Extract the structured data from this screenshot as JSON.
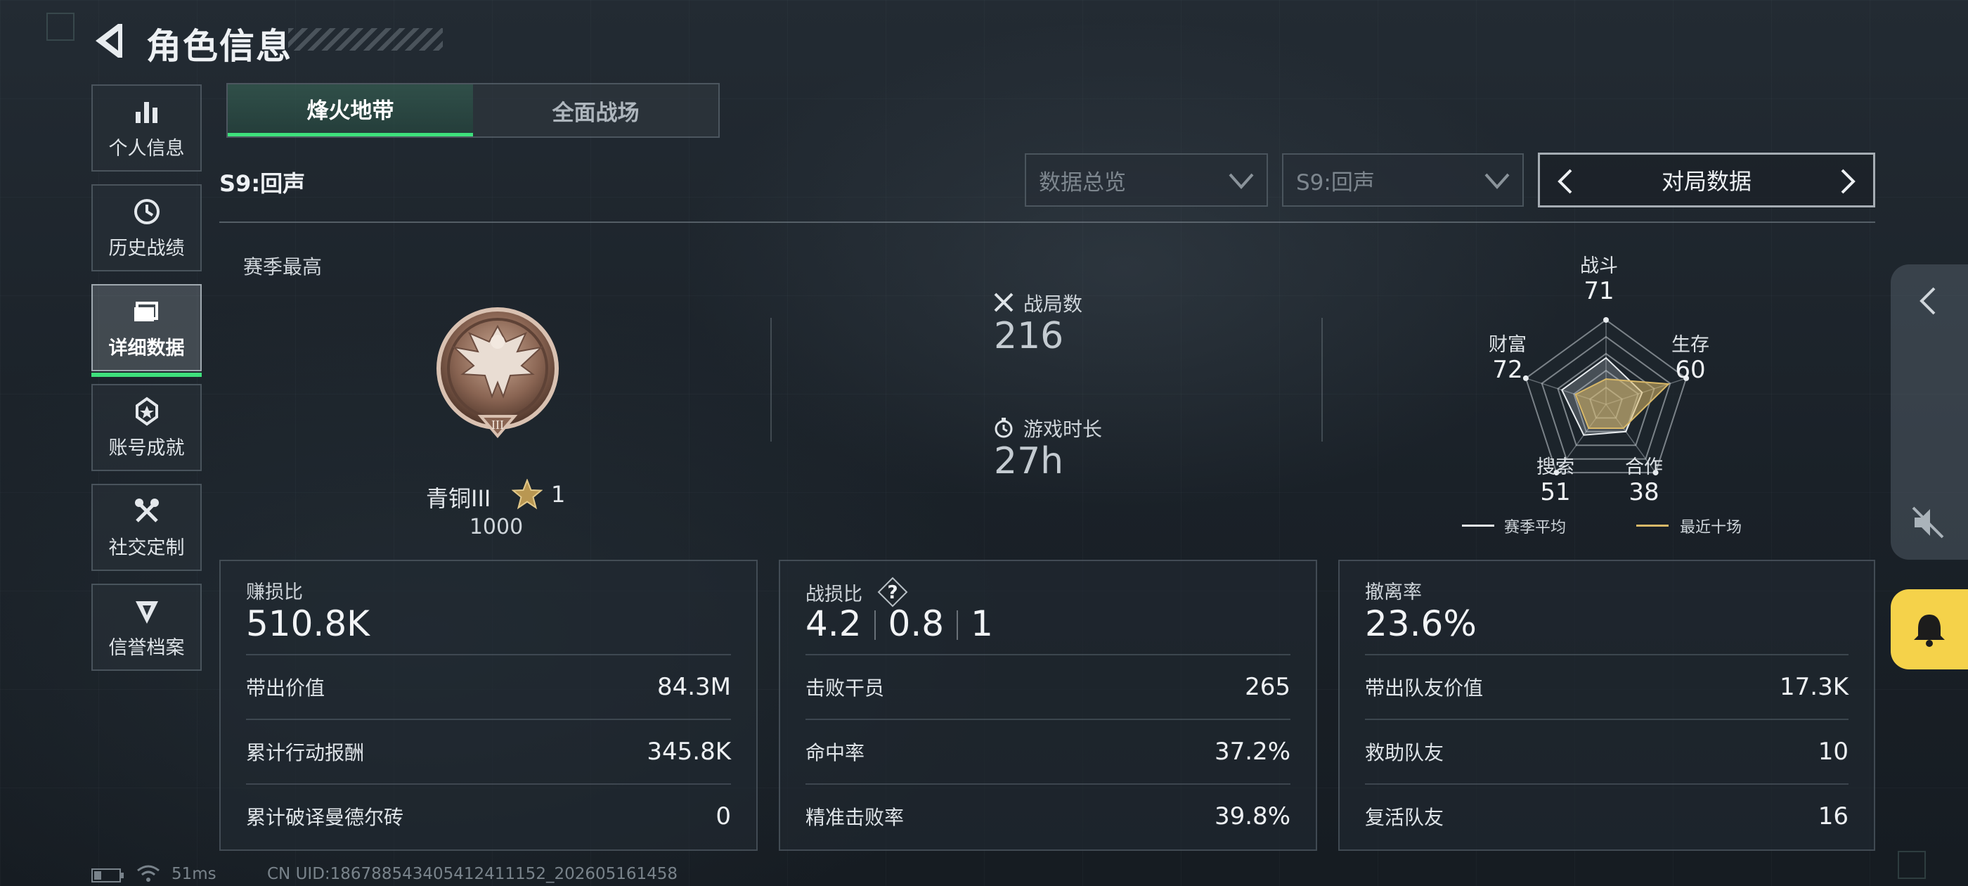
{
  "header": {
    "title": "角色信息"
  },
  "sidebar": {
    "items": [
      {
        "label": "个人信息",
        "icon": "bar-chart-icon",
        "active": false
      },
      {
        "label": "历史战绩",
        "icon": "clock-icon",
        "active": false
      },
      {
        "label": "详细数据",
        "icon": "folder-icon",
        "active": true
      },
      {
        "label": "账号成就",
        "icon": "achievement-icon",
        "active": false
      },
      {
        "label": "社交定制",
        "icon": "tools-icon",
        "active": false
      },
      {
        "label": "信誉档案",
        "icon": "shield-icon",
        "active": false
      }
    ]
  },
  "tabs": [
    {
      "label": "烽火地带",
      "active": true
    },
    {
      "label": "全面战场",
      "active": false
    }
  ],
  "season": {
    "label": "S9:回声"
  },
  "filters": {
    "overview": {
      "value": "数据总览"
    },
    "season": {
      "value": "S9:回声"
    },
    "pager": {
      "label": "对局数据"
    }
  },
  "rank": {
    "caption": "赛季最高",
    "name": "青铜III",
    "stars": "1",
    "score": "1000"
  },
  "stats": {
    "matches": {
      "label": "战局数",
      "value": "216"
    },
    "playtime": {
      "label": "游戏时长",
      "value": "27h"
    }
  },
  "radar": {
    "axes": [
      {
        "label": "战斗",
        "value": "71"
      },
      {
        "label": "生存",
        "value": "60"
      },
      {
        "label": "合作",
        "value": "38"
      },
      {
        "label": "搜索",
        "value": "51"
      },
      {
        "label": "财富",
        "value": "72"
      }
    ],
    "season_avg": [
      0.55,
      0.45,
      0.4,
      0.45,
      0.55
    ],
    "recent": [
      0.3,
      0.78,
      0.35,
      0.35,
      0.38
    ],
    "legend": {
      "season_avg": "赛季平均",
      "recent": "最近十场"
    },
    "colors": {
      "season_avg": "#e8ecef",
      "recent": "#d8b868"
    }
  },
  "cards": {
    "profit": {
      "title": "赚损比",
      "main": "510.8K",
      "rows": [
        {
          "label": "带出价值",
          "value": "84.3M"
        },
        {
          "label": "累计行动报酬",
          "value": "345.8K"
        },
        {
          "label": "累计破译曼德尔砖",
          "value": "0"
        }
      ]
    },
    "combat": {
      "title": "战损比",
      "main": [
        "4.2",
        "0.8",
        "1"
      ],
      "rows": [
        {
          "label": "击败干员",
          "value": "265"
        },
        {
          "label": "命中率",
          "value": "37.2%"
        },
        {
          "label": "精准击败率",
          "value": "39.8%"
        }
      ]
    },
    "extract": {
      "title": "撤离率",
      "main": "23.6%",
      "rows": [
        {
          "label": "带出队友价值",
          "value": "17.3K"
        },
        {
          "label": "救助队友",
          "value": "10"
        },
        {
          "label": "复活队友",
          "value": "16"
        }
      ]
    }
  },
  "footer": {
    "ping": "51ms",
    "uid": "CN UID:18678854340541241​1152_202605161458"
  },
  "colors": {
    "accent": "#3ee07c",
    "bell": "#f5d24a"
  }
}
